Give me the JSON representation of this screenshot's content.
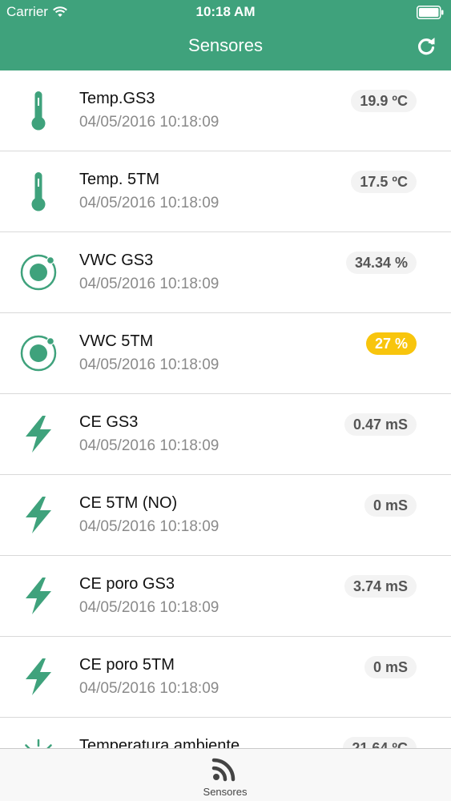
{
  "status_bar": {
    "carrier": "Carrier",
    "time": "10:18 AM"
  },
  "header": {
    "title": "Sensores",
    "refresh_icon": "refresh-icon"
  },
  "colors": {
    "primary": "#3fa27c",
    "warning_badge": "#f8c50d",
    "badge_bg": "#f3f3f3"
  },
  "sensors": [
    {
      "name": "Temp.GS3",
      "timestamp": "04/05/2016 10:18:09",
      "value": "19.9 ºC",
      "icon": "thermometer-icon",
      "status": "normal"
    },
    {
      "name": "Temp. 5TM",
      "timestamp": "04/05/2016 10:18:09",
      "value": "17.5 ºC",
      "icon": "thermometer-icon",
      "status": "normal"
    },
    {
      "name": "VWC GS3",
      "timestamp": "04/05/2016 10:18:09",
      "value": "34.34 %",
      "icon": "water-content-icon",
      "status": "normal"
    },
    {
      "name": "VWC 5TM",
      "timestamp": "04/05/2016 10:18:09",
      "value": "27 %",
      "icon": "water-content-icon",
      "status": "warning"
    },
    {
      "name": "CE GS3",
      "timestamp": "04/05/2016 10:18:09",
      "value": "0.47 mS",
      "icon": "lightning-icon",
      "status": "normal"
    },
    {
      "name": "CE 5TM (NO)",
      "timestamp": "04/05/2016 10:18:09",
      "value": "0 mS",
      "icon": "lightning-icon",
      "status": "normal"
    },
    {
      "name": "CE poro GS3",
      "timestamp": "04/05/2016 10:18:09",
      "value": "3.74 mS",
      "icon": "lightning-icon",
      "status": "normal"
    },
    {
      "name": "CE poro 5TM",
      "timestamp": "04/05/2016 10:18:09",
      "value": "0 mS",
      "icon": "lightning-icon",
      "status": "normal"
    },
    {
      "name": "Temperatura ambiente",
      "timestamp": "",
      "value": "21.64 ºC",
      "icon": "sun-icon",
      "status": "normal"
    }
  ],
  "tabbar": {
    "tabs": [
      {
        "label": "Sensores",
        "icon": "rss-feed-icon"
      }
    ]
  }
}
